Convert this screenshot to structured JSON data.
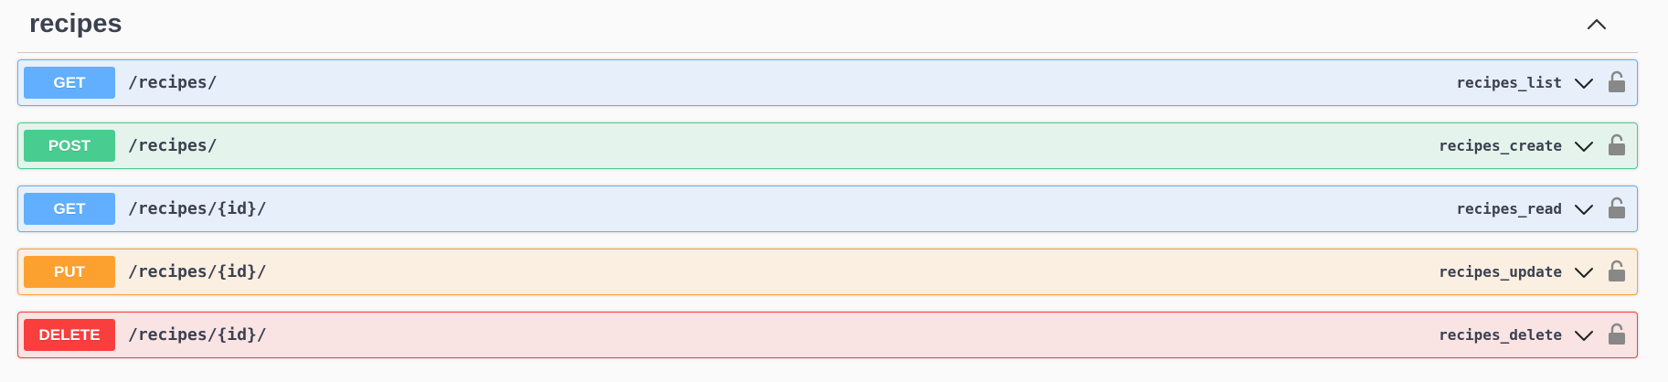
{
  "tag": {
    "title": "recipes",
    "collapse_icon": "chevron-up-icon"
  },
  "operations": [
    {
      "method": "GET",
      "path": "/recipes/",
      "summary": "recipes_list",
      "color": "#61affe"
    },
    {
      "method": "POST",
      "path": "/recipes/",
      "summary": "recipes_create",
      "color": "#49cc90"
    },
    {
      "method": "GET",
      "path": "/recipes/{id}/",
      "summary": "recipes_read",
      "color": "#61affe"
    },
    {
      "method": "PUT",
      "path": "/recipes/{id}/",
      "summary": "recipes_update",
      "color": "#fca130"
    },
    {
      "method": "DELETE",
      "path": "/recipes/{id}/",
      "summary": "recipes_delete",
      "color": "#f93e3e"
    }
  ],
  "icons": {
    "expand": "chevron-down-icon",
    "auth": "lock-icon"
  }
}
